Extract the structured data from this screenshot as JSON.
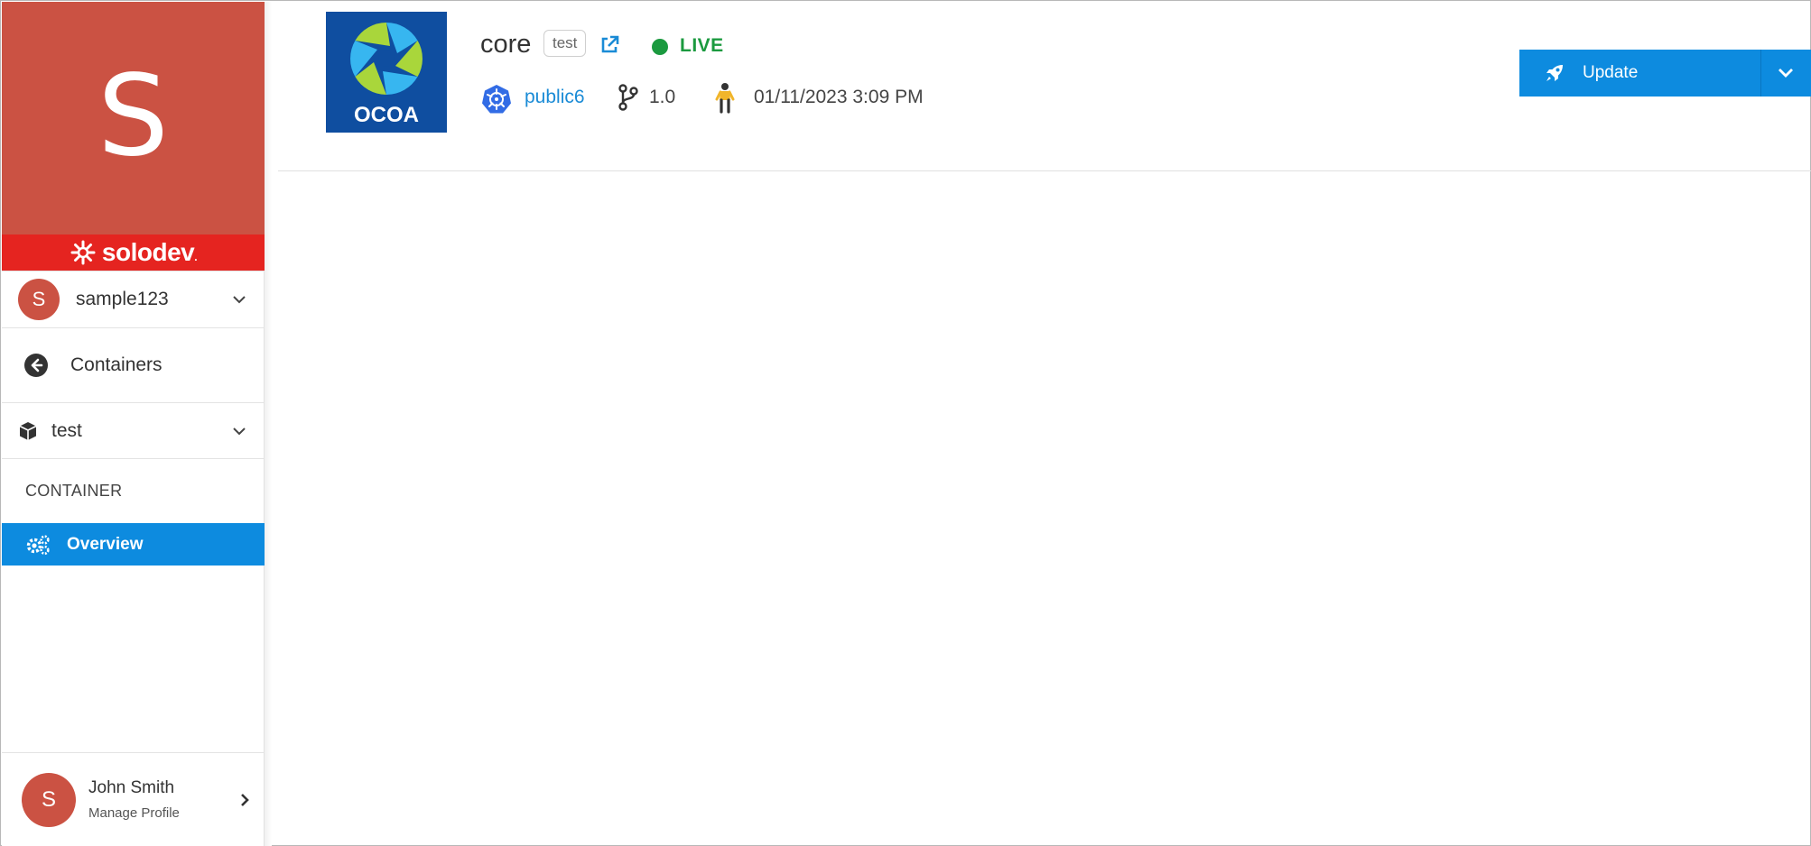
{
  "sidebar": {
    "hero_letter": "S",
    "brand": {
      "name": "solodev",
      "suffix": "."
    },
    "org": {
      "avatar_letter": "S",
      "name": "sample123"
    },
    "back": {
      "label": "Containers"
    },
    "environment": {
      "label": "test"
    },
    "section_label": "CONTAINER",
    "nav": [
      {
        "label": "Overview",
        "icon": "gears-icon",
        "active": true
      }
    ],
    "profile": {
      "avatar_letter": "S",
      "name": "John Smith",
      "link": "Manage Profile"
    }
  },
  "header": {
    "app_logo_text": "OCOA",
    "title": "core",
    "env_badge": "test",
    "status": "LIVE",
    "cluster": "public6",
    "version": "1.0",
    "deployed_at": "01/11/2023 3:09 PM"
  },
  "actions": {
    "update_label": "Update"
  },
  "colors": {
    "brand_red": "#cb5243",
    "solodev_red": "#e52420",
    "accent_blue": "#0d8bdf",
    "live_green": "#1b9a3f",
    "link_blue": "#1a8bd6"
  }
}
